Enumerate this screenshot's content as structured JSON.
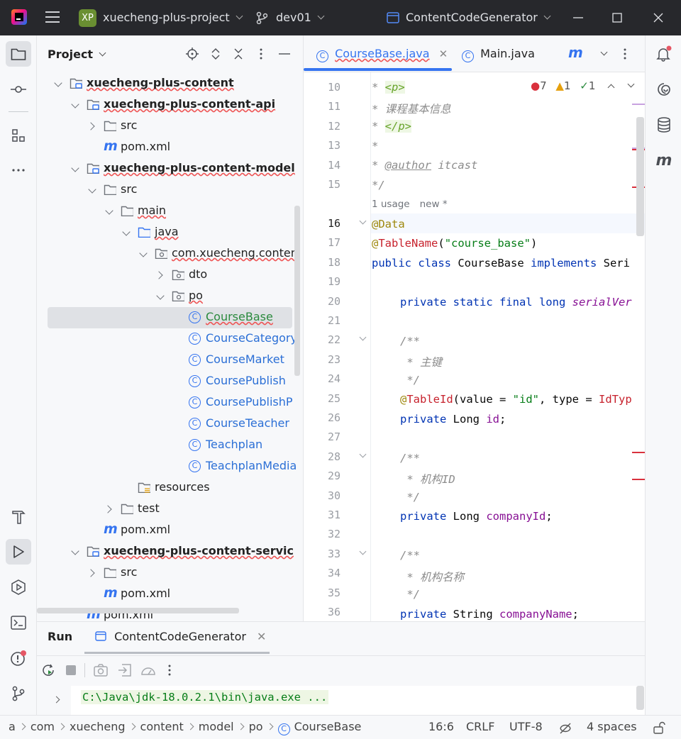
{
  "titlebar": {
    "project_badge": "XP",
    "project_name": "xuecheng-plus-project",
    "branch": "dev01",
    "run_config": "ContentCodeGenerator"
  },
  "project_panel": {
    "title": "Project",
    "tree": [
      {
        "label": "xuecheng-plus-content",
        "depth": 1,
        "kind": "module",
        "expanded": true
      },
      {
        "label": "xuecheng-plus-content-api",
        "depth": 2,
        "kind": "module",
        "expanded": true
      },
      {
        "label": "src",
        "depth": 3,
        "kind": "folder",
        "expanded": false
      },
      {
        "label": "pom.xml",
        "depth": 3,
        "kind": "maven"
      },
      {
        "label": "xuecheng-plus-content-model",
        "depth": 2,
        "kind": "module",
        "expanded": true
      },
      {
        "label": "src",
        "depth": 3,
        "kind": "folder",
        "expanded": true
      },
      {
        "label": "main",
        "depth": 4,
        "kind": "folder",
        "expanded": true
      },
      {
        "label": "java",
        "depth": 5,
        "kind": "source",
        "expanded": true
      },
      {
        "label": "com.xuecheng.conten",
        "depth": 6,
        "kind": "package",
        "expanded": true
      },
      {
        "label": "dto",
        "depth": 7,
        "kind": "package",
        "expanded": false
      },
      {
        "label": "po",
        "depth": 7,
        "kind": "package",
        "expanded": true
      },
      {
        "label": "CourseBase",
        "depth": 8,
        "kind": "class",
        "selected": true
      },
      {
        "label": "CourseCategory",
        "depth": 8,
        "kind": "class"
      },
      {
        "label": "CourseMarket",
        "depth": 8,
        "kind": "class"
      },
      {
        "label": "CoursePublish",
        "depth": 8,
        "kind": "class"
      },
      {
        "label": "CoursePublishP",
        "depth": 8,
        "kind": "class"
      },
      {
        "label": "CourseTeacher",
        "depth": 8,
        "kind": "class"
      },
      {
        "label": "Teachplan",
        "depth": 8,
        "kind": "class"
      },
      {
        "label": "TeachplanMedia",
        "depth": 8,
        "kind": "class"
      },
      {
        "label": "resources",
        "depth": 5,
        "kind": "resources"
      },
      {
        "label": "test",
        "depth": 4,
        "kind": "folder",
        "expanded": false
      },
      {
        "label": "pom.xml",
        "depth": 3,
        "kind": "maven"
      },
      {
        "label": "xuecheng-plus-content-servic",
        "depth": 2,
        "kind": "module",
        "expanded": true
      },
      {
        "label": "src",
        "depth": 3,
        "kind": "folder",
        "expanded": false
      },
      {
        "label": "pom.xml",
        "depth": 3,
        "kind": "maven"
      },
      {
        "label": "pom.xml",
        "depth": 2,
        "kind": "maven"
      }
    ]
  },
  "editor": {
    "tabs": [
      {
        "label": "CourseBase.java",
        "active": true
      },
      {
        "label": "Main.java",
        "active": false
      }
    ],
    "inspections": {
      "errors": "7",
      "warnings": "1",
      "ok": "1"
    },
    "usage_hint": "1 usage",
    "new_hint": "new *",
    "line_numbers": [
      "10",
      "11",
      "12",
      "13",
      "14",
      "15",
      "16",
      "17",
      "18",
      "19",
      "20",
      "21",
      "22",
      "23",
      "24",
      "25",
      "26",
      "27",
      "28",
      "29",
      "30",
      "31",
      "32",
      "33",
      "34",
      "35",
      "36"
    ],
    "code": {
      "l10_a": "* ",
      "l10_tag": "<p>",
      "l11": "* 课程基本信息",
      "l12_a": "* ",
      "l12_tag": "</p>",
      "l13": "*",
      "l14_a": "* ",
      "l14_tag": "@author",
      "l14_b": " itcast",
      "l15": "*/",
      "l16": "@Data",
      "l17_a": "@",
      "l17_ann": "TableName",
      "l17_b": "(",
      "l17_str": "\"course_base\"",
      "l17_c": ")",
      "l18_kw": "public class ",
      "l18_name": "CourseBase ",
      "l18_kw2": "implements ",
      "l18_rest": "Seri",
      "l20_kw": "private static final long ",
      "l20_fld": "serialVer",
      "l22": "/**",
      "l23": " * 主键",
      "l24": " */",
      "l25_a": "@",
      "l25_ann": "TableId",
      "l25_b": "(value = ",
      "l25_str": "\"id\"",
      "l25_c": ", type = ",
      "l25_red": "IdTyp",
      "l26_kw": "private ",
      "l26_type": "Long ",
      "l26_fld": "id",
      "l26_end": ";",
      "l28": "/**",
      "l29": " * 机构ID",
      "l30": " */",
      "l31_kw": "private ",
      "l31_type": "Long ",
      "l31_fld": "companyId",
      "l31_end": ";",
      "l33": "/**",
      "l34": " * 机构名称",
      "l35": " */",
      "l36_kw": "private ",
      "l36_type": "String ",
      "l36_fld": "companyName",
      "l36_end": ";"
    }
  },
  "run_panel": {
    "title": "Run",
    "tab": "ContentCodeGenerator",
    "console_line": "C:\\Java\\jdk-18.0.2.1\\bin\\java.exe ..."
  },
  "statusbar": {
    "breadcrumb": [
      "a",
      "com",
      "xuecheng",
      "content",
      "model",
      "po",
      "CourseBase"
    ],
    "position": "16:6",
    "line_sep": "CRLF",
    "encoding": "UTF-8",
    "indent": "4 spaces"
  },
  "colors": {
    "accent": "#3574f0",
    "titlebar": "#27282c",
    "error": "#d9313d",
    "warning": "#e5a00d"
  }
}
